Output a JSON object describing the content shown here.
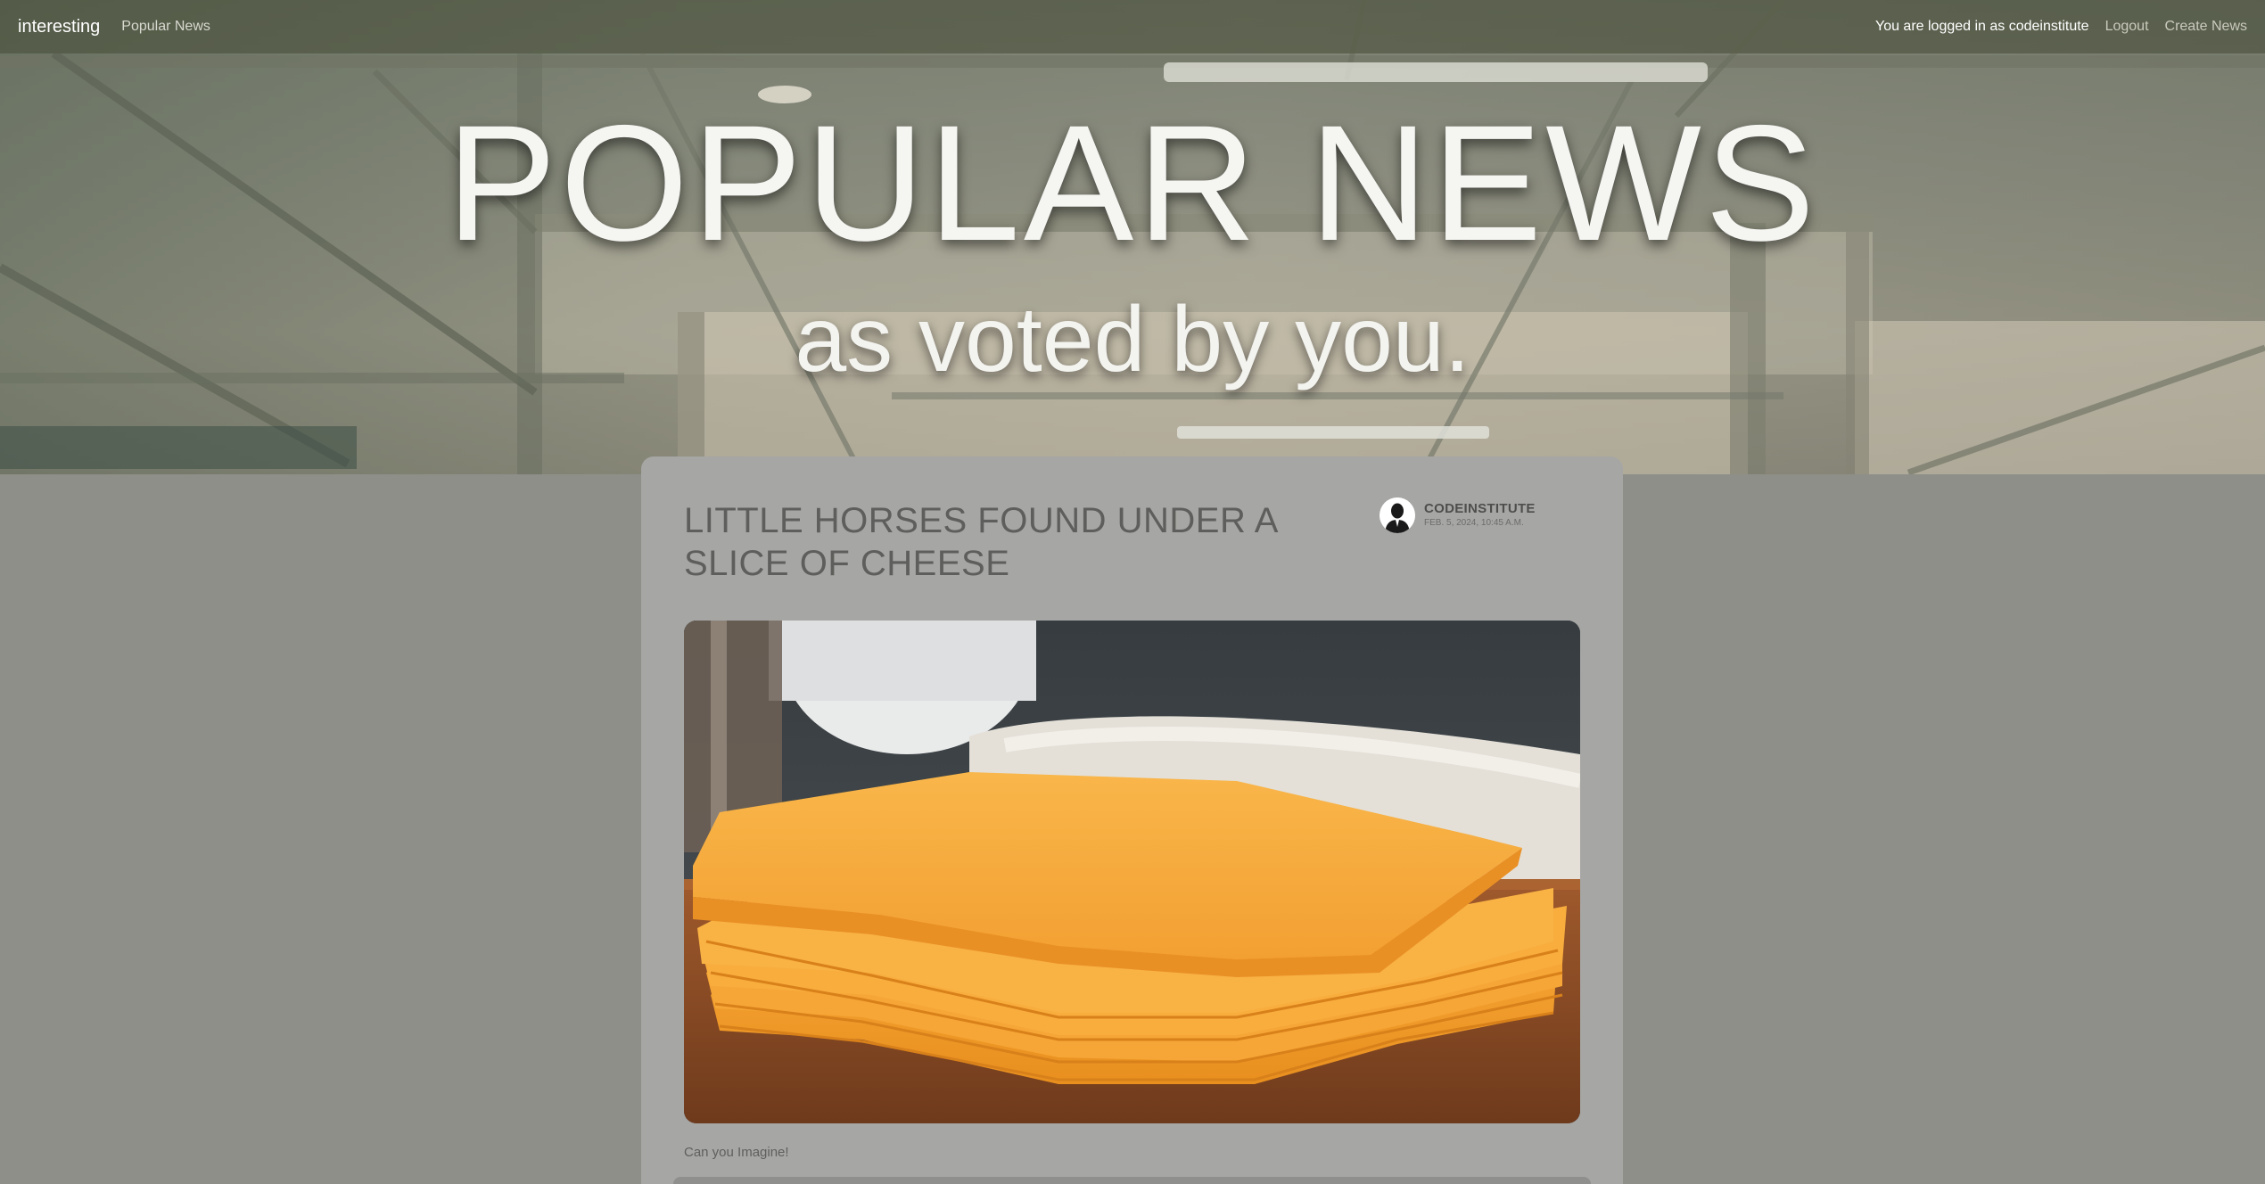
{
  "navbar": {
    "brand": "interesting",
    "popular_link": "Popular News",
    "logged_in_text": "You are logged in as codeinstitute",
    "logout_link": "Logout",
    "create_link": "Create News"
  },
  "hero": {
    "title": "POPULAR NEWS",
    "subtitle": "as voted by you."
  },
  "post": {
    "title": "LITTLE HORSES FOUND UNDER A SLICE OF CHEESE",
    "author": "CODEINSTITUTE",
    "date": "FEB. 5, 2024, 10:45 A.M.",
    "caption": "Can you Imagine!"
  },
  "colors": {
    "background": "#8e8f88",
    "card": "#a6a6a4",
    "navbar": "#585c46",
    "title_text": "#5e5e5c"
  },
  "icons": {
    "avatar": "person-silhouette-icon"
  }
}
